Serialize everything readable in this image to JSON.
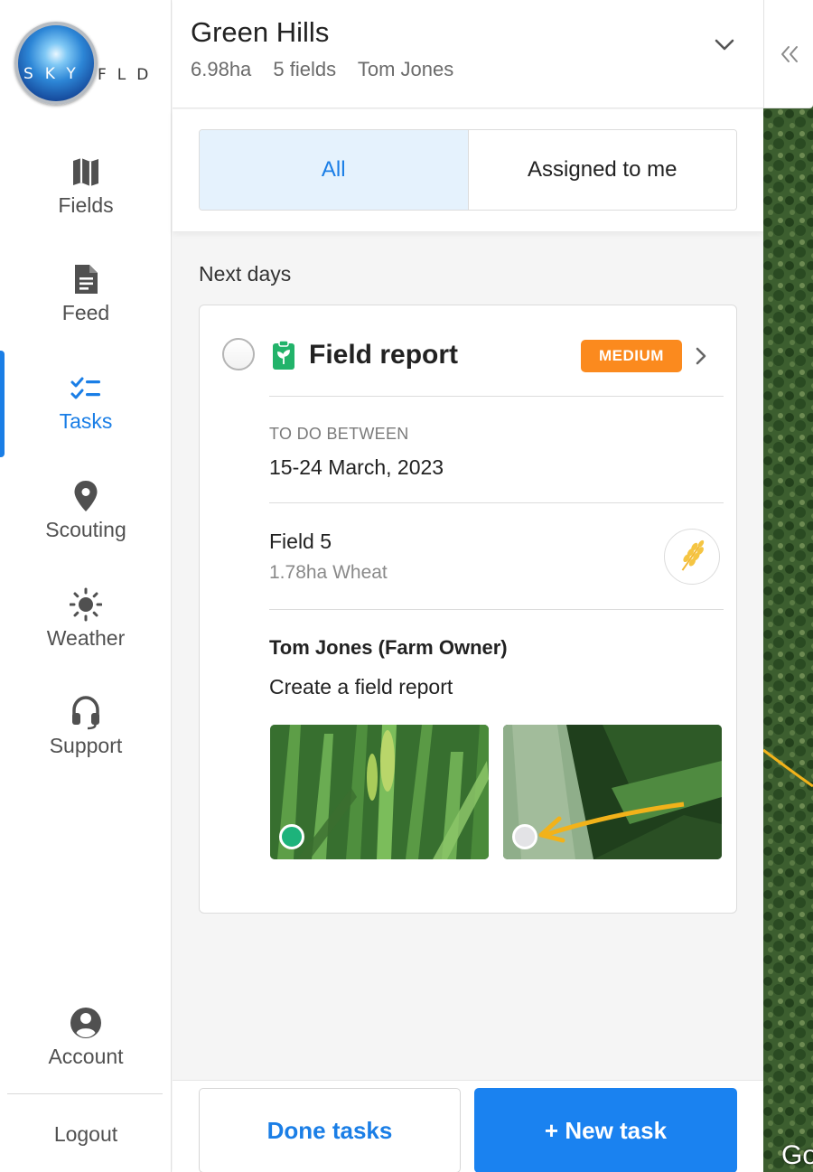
{
  "logo": {
    "text_on_globe": "SKY",
    "text_after": "FLD"
  },
  "sidebar": {
    "items": [
      {
        "label": "Fields",
        "icon": "map-icon"
      },
      {
        "label": "Feed",
        "icon": "document-icon"
      },
      {
        "label": "Tasks",
        "icon": "checklist-icon",
        "active": true
      },
      {
        "label": "Scouting",
        "icon": "location-pin-icon"
      },
      {
        "label": "Weather",
        "icon": "sun-icon"
      },
      {
        "label": "Support",
        "icon": "headset-icon"
      }
    ],
    "account_label": "Account",
    "logout_label": "Logout"
  },
  "header": {
    "farm_name": "Green Hills",
    "area": "6.98ha",
    "fields_count": "5 fields",
    "owner": "Tom Jones"
  },
  "filter": {
    "all_label": "All",
    "assigned_label": "Assigned to me",
    "selected": "All"
  },
  "section_title": "Next days",
  "task": {
    "title": "Field report",
    "priority": "MEDIUM",
    "due_label": "TO DO BETWEEN",
    "due_dates": "15-24 March, 2023",
    "field_name": "Field 5",
    "field_meta": "1.78ha Wheat",
    "assignee": "Tom Jones (Farm Owner)",
    "description": "Create a field report"
  },
  "buttons": {
    "done_tasks": "Done tasks",
    "new_task": "+ New task"
  },
  "map": {
    "attribution_fragment": "Go"
  },
  "colors": {
    "accent": "#1a7ee6",
    "priority_medium": "#fb8a1e",
    "report_icon": "#22b36a",
    "photo_dot_done": "#1db37b",
    "photo_dot_pending": "#e3e3e6",
    "annotation_arrow": "#f2b21a"
  }
}
